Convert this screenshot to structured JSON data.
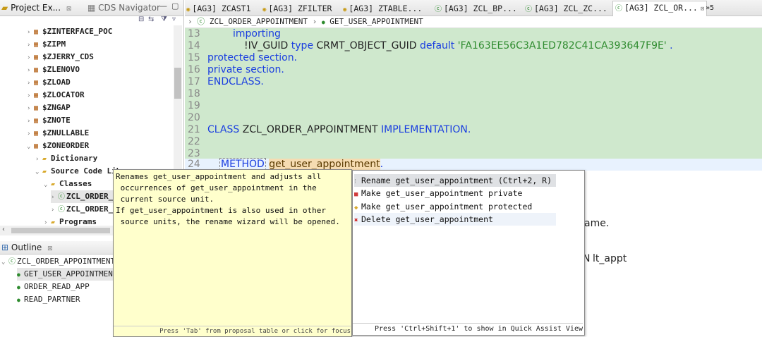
{
  "left_panel": {
    "tabs": [
      {
        "label": "Project Ex...",
        "close": "⊠"
      },
      {
        "label": "CDS Navigator",
        "close": ""
      }
    ],
    "tree": [
      {
        "label": "$ZINTERFACE_POC"
      },
      {
        "label": "$ZIPM"
      },
      {
        "label": "$ZJERRY_CDS"
      },
      {
        "label": "$ZLENOVO"
      },
      {
        "label": "$ZLOAD"
      },
      {
        "label": "$ZLOCATOR"
      },
      {
        "label": "$ZNGAP"
      },
      {
        "label": "$ZNOTE"
      },
      {
        "label": "$ZNULLABLE"
      },
      {
        "label": "$ZONEORDER"
      },
      {
        "label": "Dictionary"
      },
      {
        "label": "Source Code Library"
      },
      {
        "label": "Classes"
      },
      {
        "label": "ZCL_ORDER_"
      },
      {
        "label": "ZCL_ORDER_"
      },
      {
        "label": "Programs"
      }
    ]
  },
  "outline": {
    "title": "Outline",
    "root": "ZCL_ORDER_APPOINTMENT",
    "items": [
      "GET_USER_APPOINTMEN",
      "ORDER_READ_APP",
      "READ_PARTNER"
    ]
  },
  "editor": {
    "tabs": [
      "[AG3] ZCAST1",
      "[AG3] ZFILTER",
      "[AG3] ZTABLE...",
      "[AG3] ZCL_BP...",
      "[AG3] ZCL_ZC...",
      "[AG3] ZCL_OR..."
    ],
    "overflow": "»5",
    "breadcrumb": [
      "ZCL_ORDER_APPOINTMENT",
      "GET_USER_APPOINTMENT"
    ],
    "line_numbers": [
      "13",
      "14",
      "15",
      "16",
      "17",
      "18",
      "19",
      "20",
      "21",
      "22",
      "23",
      "24"
    ],
    "code": {
      "l13": "importing",
      "l14_a": "!IV_GUID ",
      "l14_type": "type",
      "l14_b": " CRMT_OBJECT_GUID ",
      "l14_default": "default",
      "l14_str": "'FA163EE56C3A1ED782C41CA393647F9E'",
      "l14_dot": " .",
      "l15": "protected section.",
      "l16": "private section.",
      "l17": "ENDCLASS.",
      "l21_a": "CLASS ",
      "l21_b": "ZCL_ORDER_APPOINTMENT ",
      "l21_c": "IMPLEMENTATION.",
      "l24_kw": "METHOD",
      "l24_name": "get_user_appointment",
      "l24_end": ".",
      "frag_ame": "ame.",
      "frag_lt": "lt_appt"
    }
  },
  "tooltip": {
    "lines": [
      "Renames get_user_appointment and adjusts all",
      " occurrences of get_user_appointment in the",
      " current source unit.",
      "If get_user_appointment is also used in other",
      " source units, the rename wizard will be opened."
    ],
    "footer": "Press 'Tab' from proposal table or click for focus"
  },
  "quick_assist": {
    "items": [
      {
        "label": "Rename get_user_appointment   (Ctrl+2, R)",
        "icon": "rename-icon"
      },
      {
        "label": "Make get_user_appointment private",
        "icon": "private-icon"
      },
      {
        "label": "Make get_user_appointment protected",
        "icon": "protected-icon"
      },
      {
        "label": "Delete get_user_appointment",
        "icon": "delete-icon"
      }
    ],
    "footer": "Press 'Ctrl+Shift+1' to show in Quick Assist View"
  }
}
